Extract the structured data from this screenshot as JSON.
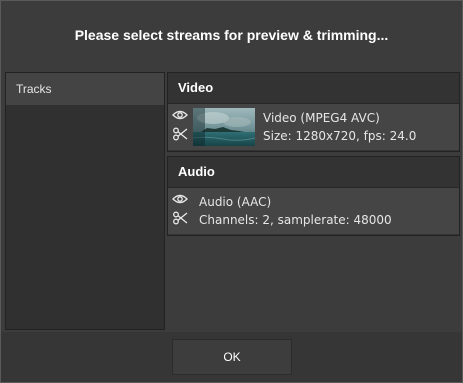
{
  "dialog": {
    "title": "Please select streams for preview & trimming..."
  },
  "sidebar": {
    "items": [
      {
        "label": "Tracks"
      }
    ]
  },
  "video": {
    "header": "Video",
    "stream": {
      "name": "Video (MPEG4 AVC)",
      "details": "Size: 1280x720, fps: 24.0",
      "icons": [
        "eye-icon",
        "scissors-icon"
      ]
    }
  },
  "audio": {
    "header": "Audio",
    "stream": {
      "name": "Audio (AAC)",
      "details": "Channels: 2, samplerate: 48000",
      "icons": [
        "eye-icon",
        "scissors-icon"
      ]
    }
  },
  "footer": {
    "ok_label": "OK"
  }
}
